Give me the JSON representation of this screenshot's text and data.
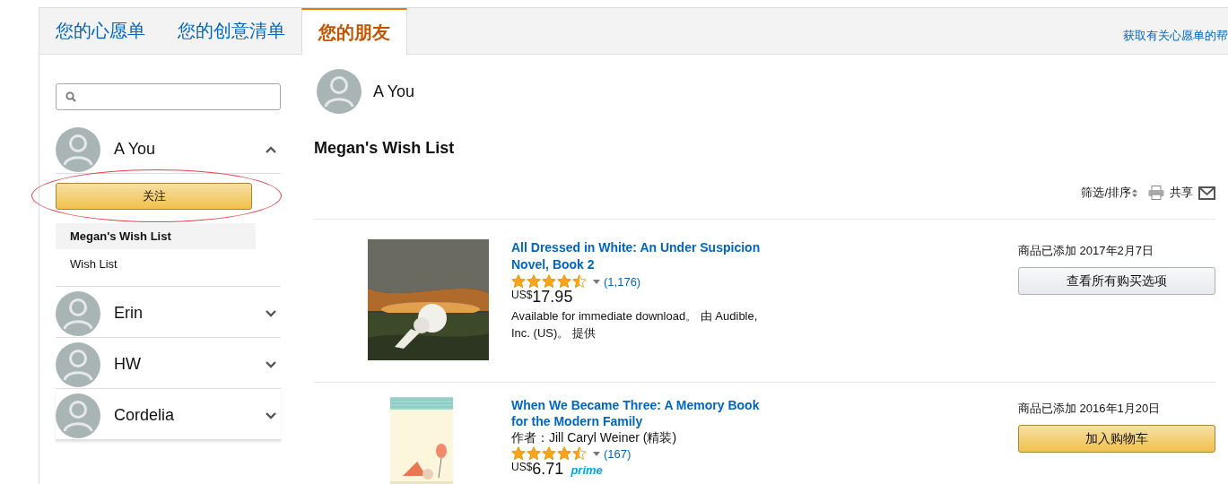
{
  "tabs": [
    {
      "label": "您的心愿单",
      "selected": false
    },
    {
      "label": "您的创意清单",
      "selected": false
    },
    {
      "label": "您的朋友",
      "selected": true
    }
  ],
  "help_link": "获取有关心愿单的帮",
  "sidebar": {
    "friends": [
      {
        "name": "A You",
        "expanded": true,
        "follow_button": "关注",
        "follow_highlighted": true,
        "lists": [
          {
            "name": "Megan's Wish List",
            "selected": true
          },
          {
            "name": "Wish List",
            "selected": false
          }
        ]
      },
      {
        "name": "Erin",
        "expanded": false
      },
      {
        "name": "HW",
        "expanded": false
      },
      {
        "name": "Cordelia",
        "expanded": false
      }
    ]
  },
  "profile": {
    "name": "A You"
  },
  "list_title": "Megan's Wish List",
  "toolbar": {
    "filter_sort": "筛选/排序",
    "share": "共享"
  },
  "items": [
    {
      "title": "All Dressed in White: An Under Suspicion Novel, Book 2",
      "stars": 4.5,
      "reviews": "(1,176)",
      "currency": "US$",
      "price": "17.95",
      "availability": "Available for immediate download。 由 Audible, Inc. (US)。 提供",
      "added": "商品已添加 2017年2月7日",
      "button": {
        "label": "查看所有购买选项",
        "kind": "secondary"
      }
    },
    {
      "title": "When We Became Three: A Memory Book for the Modern Family",
      "byline": "作者：Jill Caryl Weiner (精装)",
      "stars": 4.5,
      "reviews": "(167)",
      "currency": "US$",
      "price": "6.71",
      "badge": "prime",
      "added": "商品已添加 2016年1月20日",
      "button": {
        "label": "加入购物车",
        "kind": "primary"
      }
    }
  ]
}
